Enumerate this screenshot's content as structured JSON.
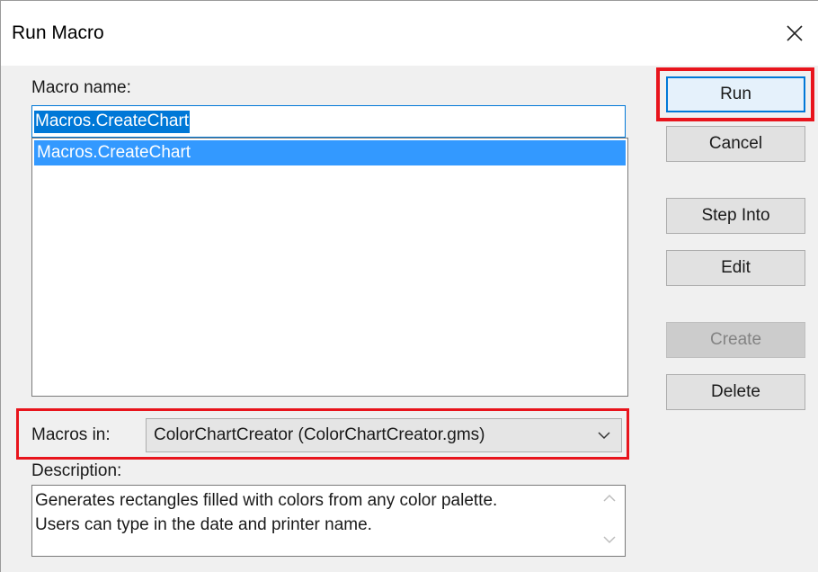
{
  "window": {
    "title": "Run Macro",
    "close_icon": "close-icon"
  },
  "macro_name": {
    "label": "Macro name:",
    "value": "Macros.CreateChart"
  },
  "macro_list": {
    "items": [
      "Macros.CreateChart"
    ],
    "selected_index": 0
  },
  "macros_in": {
    "label": "Macros in:",
    "selected": "ColorChartCreator (ColorChartCreator.gms)",
    "icon": "chevron-down-icon"
  },
  "description": {
    "label": "Description:",
    "lines": [
      "Generates rectangles filled with colors from any color palette.",
      "Users can type in the date and printer name."
    ]
  },
  "buttons": {
    "run": "Run",
    "cancel": "Cancel",
    "step_into": "Step Into",
    "edit": "Edit",
    "create": "Create",
    "delete": "Delete"
  },
  "colors": {
    "highlight_box": "#e8141c",
    "selection": "#0078d7",
    "list_selection": "#3399ff",
    "dialog_bg": "#f0f0f0"
  }
}
